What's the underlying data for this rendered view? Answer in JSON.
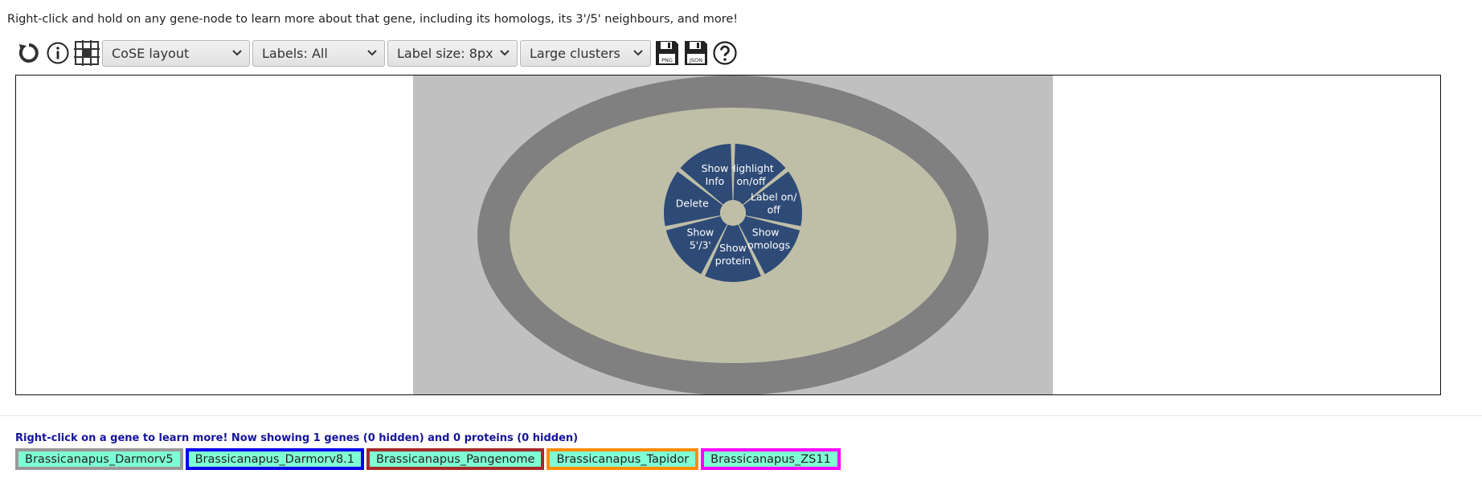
{
  "hint_text": "Right-click and hold on any gene-node to learn more about that gene, including its homologs, its 3'/5' neighbours, and more!",
  "toolbar": {
    "icons": [
      "refresh-icon",
      "info-icon",
      "grid-icon"
    ],
    "layout_select": "CoSE layout",
    "labels_select": "Labels: All",
    "label_size_select": "Label size: 8px",
    "clusters_select": "Large clusters",
    "save_png_label": "PNG",
    "save_json_label": "JSON",
    "help_icon": "help-icon"
  },
  "context_menu": {
    "items": [
      {
        "name": "highlight",
        "lines": [
          "Highlight",
          "on/off"
        ]
      },
      {
        "name": "label",
        "lines": [
          "Label on/",
          "off"
        ]
      },
      {
        "name": "show-homologs",
        "lines": [
          "Show",
          "homologs"
        ]
      },
      {
        "name": "show-protein",
        "lines": [
          "Show",
          "protein"
        ]
      },
      {
        "name": "show-neighbours",
        "lines": [
          "Show",
          "5'/3'"
        ]
      },
      {
        "name": "delete",
        "lines": [
          "Delete"
        ]
      },
      {
        "name": "show-info",
        "lines": [
          "Show",
          "Info"
        ]
      }
    ],
    "colors": {
      "slice": "#2e4a76",
      "ring": "#808080",
      "node": "#bfbfa8",
      "stage": "#c0c0c0"
    }
  },
  "status_text": "Right-click on a gene to learn more! Now showing 1 genes (0 hidden) and 0 proteins (0 hidden)",
  "legend": [
    {
      "label": "Brassicanapus_Darmorv5",
      "border": "#999999"
    },
    {
      "label": "Brassicanapus_Darmorv8.1",
      "border": "#0000ee"
    },
    {
      "label": "Brassicanapus_Pangenome",
      "border": "#a52a2a"
    },
    {
      "label": "Brassicanapus_Tapidor",
      "border": "#ff8c00"
    },
    {
      "label": "Brassicanapus_ZS11",
      "border": "#ff00ff"
    }
  ]
}
